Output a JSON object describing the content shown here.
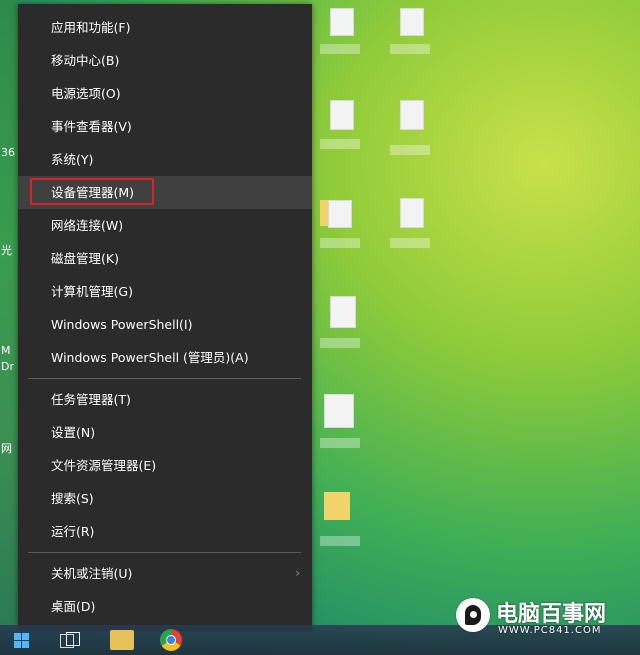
{
  "left_edge_fragments": [
    "36",
    "光",
    "M",
    "Dr",
    "网"
  ],
  "menu": {
    "group1": [
      {
        "label": "应用和功能(F)"
      },
      {
        "label": "移动中心(B)"
      },
      {
        "label": "电源选项(O)"
      },
      {
        "label": "事件查看器(V)"
      },
      {
        "label": "系统(Y)"
      },
      {
        "label": "设备管理器(M)",
        "highlighted": true
      },
      {
        "label": "网络连接(W)"
      },
      {
        "label": "磁盘管理(K)"
      },
      {
        "label": "计算机管理(G)"
      },
      {
        "label": "Windows PowerShell(I)"
      },
      {
        "label": "Windows PowerShell (管理员)(A)"
      }
    ],
    "group2": [
      {
        "label": "任务管理器(T)"
      },
      {
        "label": "设置(N)"
      },
      {
        "label": "文件资源管理器(E)"
      },
      {
        "label": "搜索(S)"
      },
      {
        "label": "运行(R)"
      }
    ],
    "group3": [
      {
        "label": "关机或注销(U)",
        "has_submenu": true,
        "submenu_icon": "chevron-right-icon"
      },
      {
        "label": "桌面(D)"
      }
    ]
  },
  "taskbar": {
    "icons": [
      "windows-start-icon",
      "task-view-icon",
      "file-explorer-icon",
      "chrome-icon"
    ]
  },
  "watermark": {
    "name": "电脑百事网",
    "url": "WWW.PC841.COM"
  },
  "colors": {
    "menu_bg": "#2b2b2b",
    "menu_hover": "#404040",
    "highlight_border": "#d82328",
    "text": "#ffffff"
  }
}
